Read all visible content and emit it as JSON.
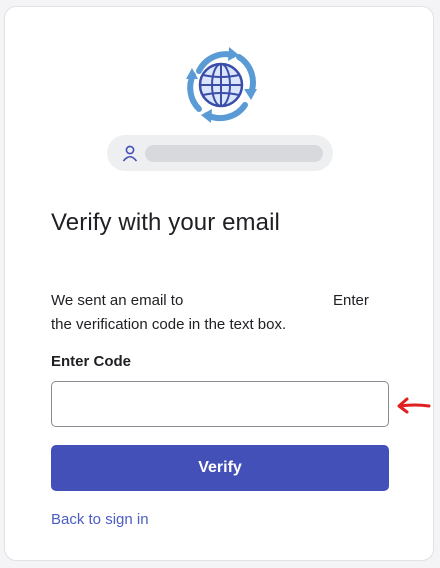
{
  "header": {
    "logo_icon": "globe-sync-icon",
    "identity": {
      "icon": "person-icon",
      "value_redacted": true
    }
  },
  "main": {
    "title": "Verify with your email",
    "description_line1_start": "We sent an email to",
    "description_line1_end": "Enter",
    "description_line2": "the verification code in the text box.",
    "code_label": "Enter Code",
    "code_value": "",
    "code_placeholder": "",
    "verify_label": "Verify",
    "back_label": "Back to sign in"
  },
  "colors": {
    "primary_button": "#4250b8",
    "link": "#4b5dc2",
    "annotation_arrow": "#e02020",
    "logo_blue": "#5b9bd5",
    "logo_navy": "#3a4ea8"
  }
}
